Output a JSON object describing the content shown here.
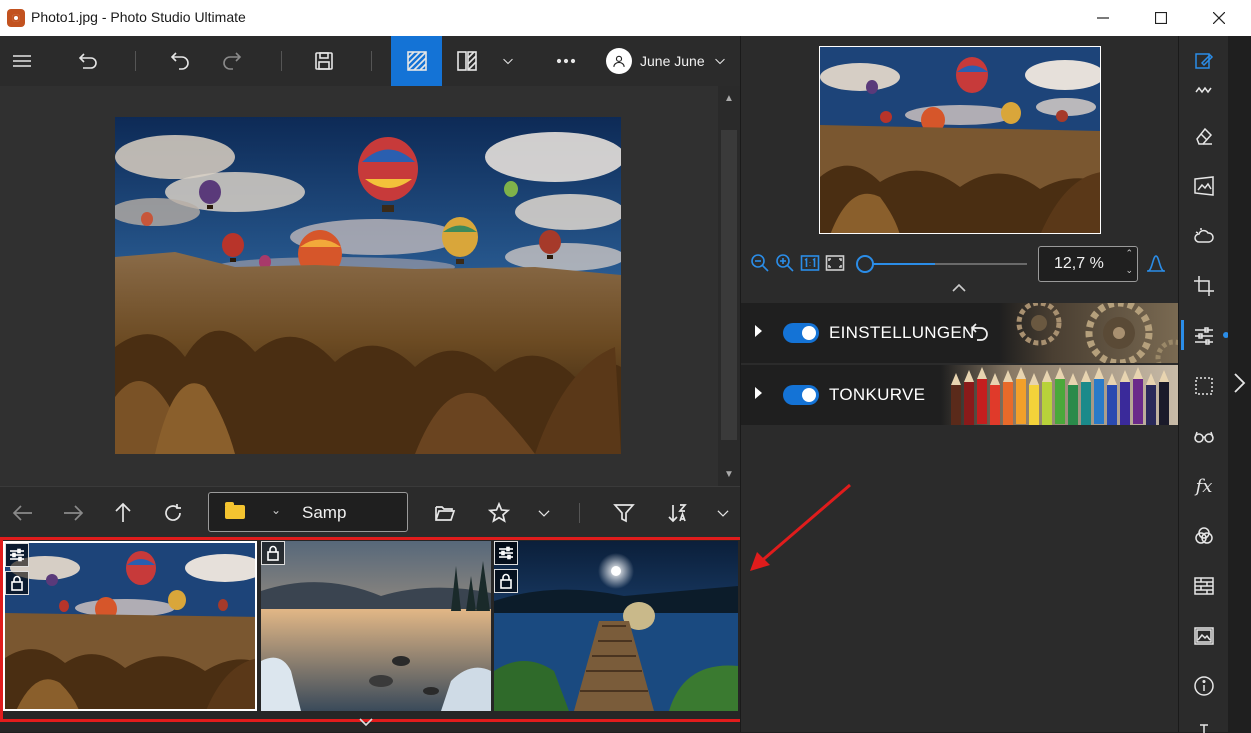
{
  "window": {
    "title": "Photo1.jpg - Photo Studio Ultimate",
    "minimize_label": "—",
    "maximize_label": "☐",
    "close_label": "✕"
  },
  "toolbar": {
    "user_name": "June June"
  },
  "navbar": {
    "folder_name": "Samp"
  },
  "zoom": {
    "value_text": "12,7 %",
    "slider_fraction": 0.45
  },
  "panels": [
    {
      "label": "EINSTELLUNGEN",
      "enabled": true
    },
    {
      "label": "TONKURVE",
      "enabled": true
    }
  ],
  "thumbnails": [
    {
      "name": "hot-air-balloons",
      "selected": true,
      "badges": [
        "adjustments-icon",
        "lock-icon"
      ]
    },
    {
      "name": "lake-sunset",
      "selected": false,
      "badges": [
        "lock-icon"
      ]
    },
    {
      "name": "night-pier",
      "selected": false,
      "badges": [
        "adjustments-icon",
        "lock-icon"
      ]
    }
  ],
  "colors": {
    "accent": "#1473d6",
    "highlight": "#e01c1c",
    "toolbar_bg": "#2b2b2b"
  }
}
